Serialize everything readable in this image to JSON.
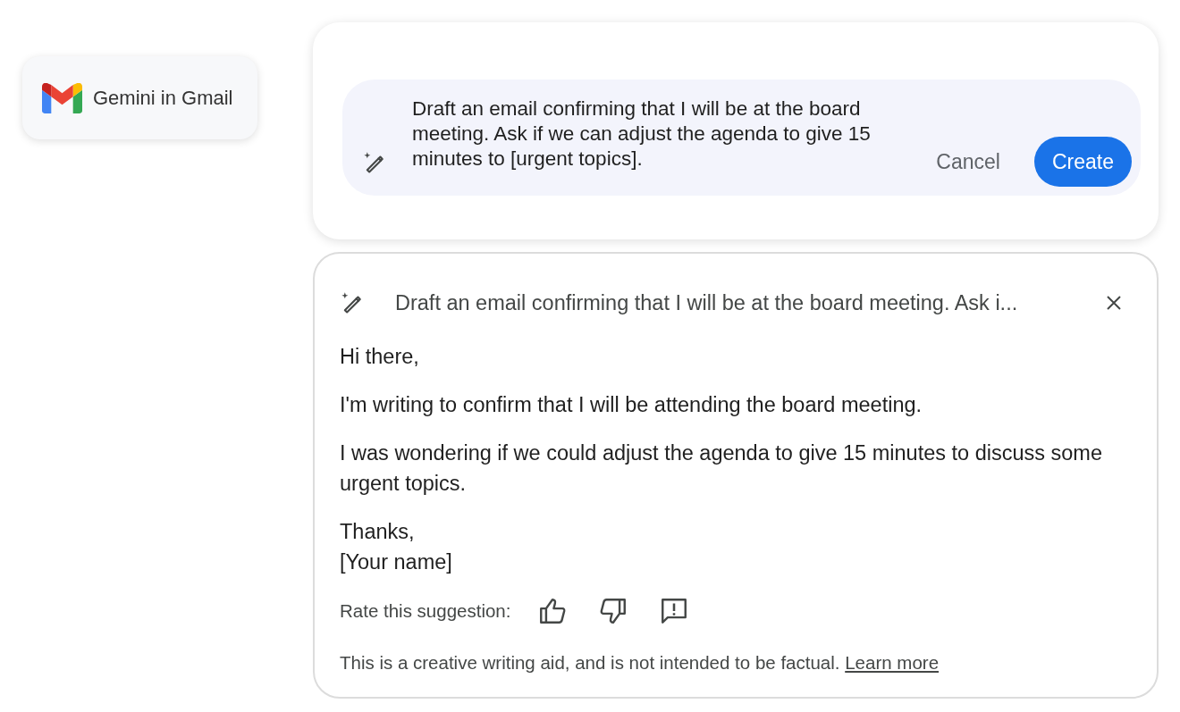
{
  "badge": {
    "label": "Gemini in Gmail"
  },
  "prompt": {
    "value": "Draft an email confirming that I will be at the board meeting. Ask if we can adjust the agenda to give 15 minutes to [urgent topics].",
    "buttons": [
      {
        "label": "Cancel",
        "kind": "text"
      },
      {
        "label": "Create",
        "kind": "filled"
      }
    ]
  },
  "result": {
    "title": "Draft an email confirming that I will be at the board meeting. Ask i...",
    "paragraphs": [
      "Hi there,",
      "I'm writing to confirm that I will be attending the board meeting.",
      "I was wondering if we could adjust the agenda to give 15 minutes to discuss some urgent topics.",
      "Thanks,\n[Your name]"
    ],
    "rating_label": "Rate this suggestion:",
    "disclaimer": "This is a creative writing aid, and is not intended to be factual.",
    "link": "Learn more"
  }
}
